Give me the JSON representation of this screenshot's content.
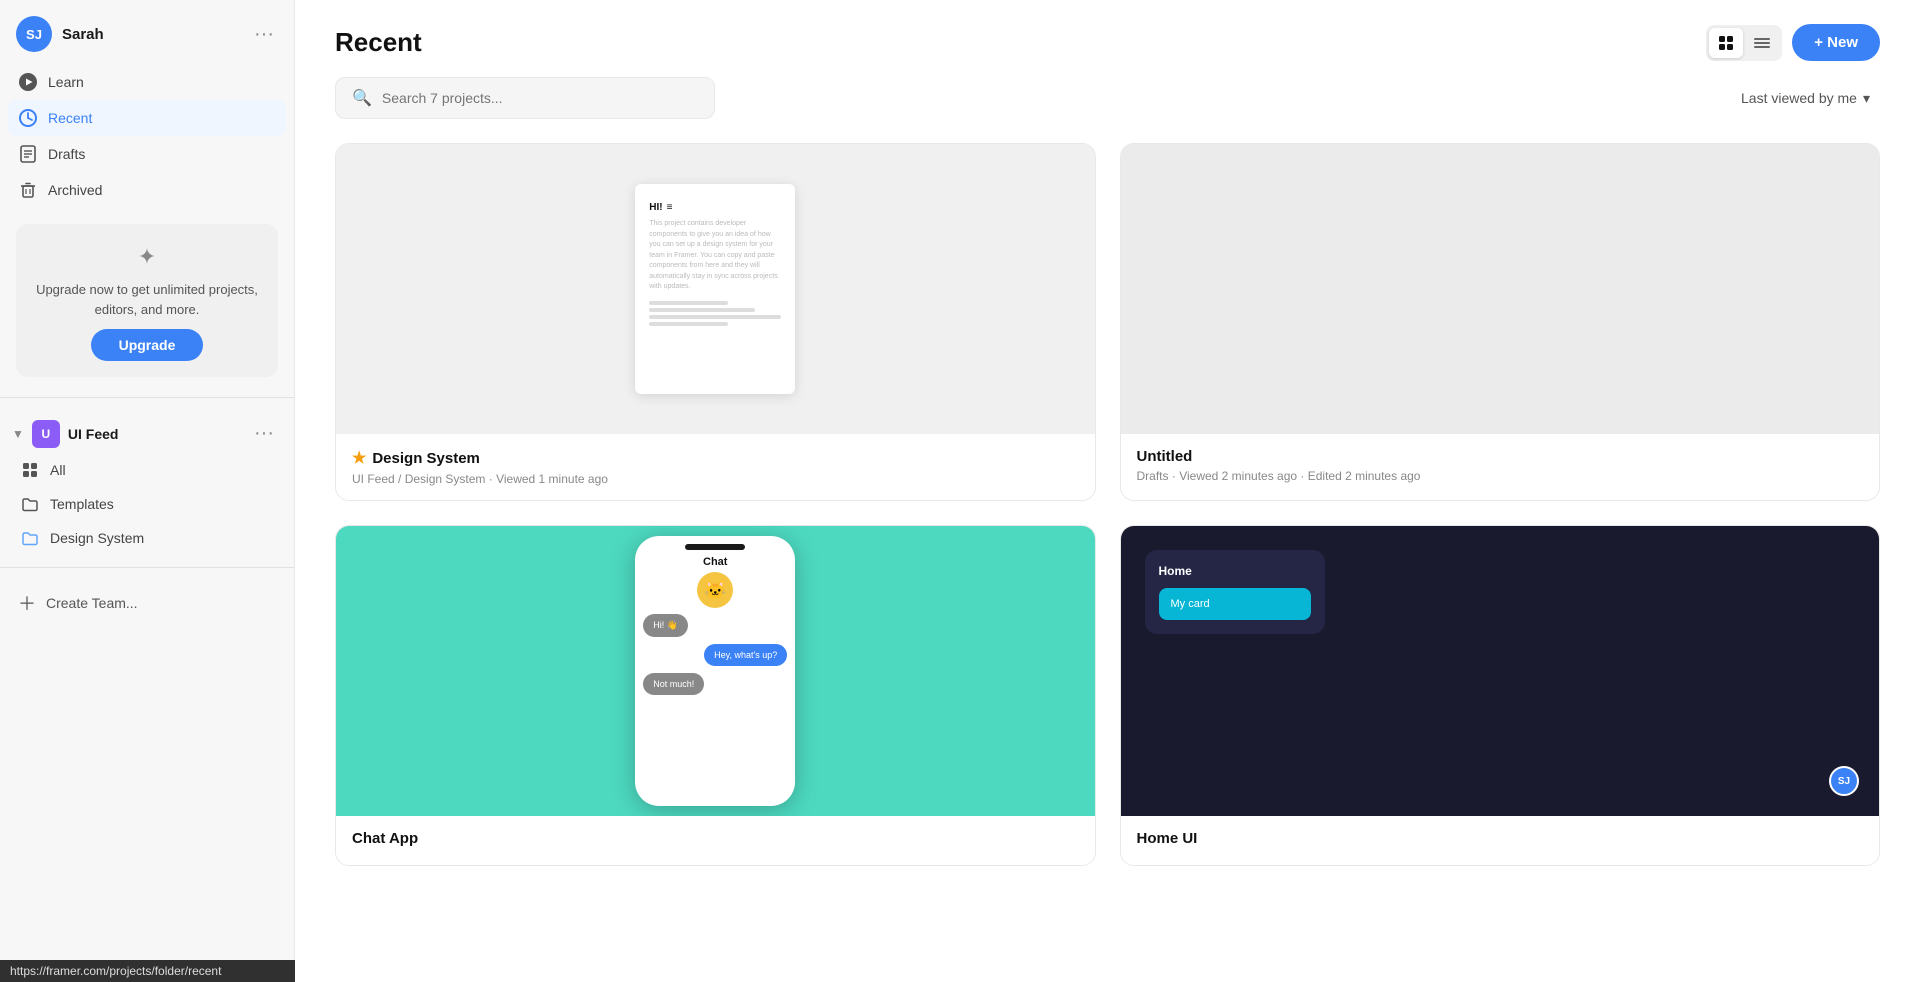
{
  "sidebar": {
    "user": {
      "name": "Sarah",
      "initials": "SJ",
      "avatar_color": "#3b82f6"
    },
    "nav_items": [
      {
        "id": "learn",
        "label": "Learn",
        "icon": "play-icon"
      },
      {
        "id": "recent",
        "label": "Recent",
        "icon": "clock-icon",
        "active": true
      },
      {
        "id": "drafts",
        "label": "Drafts",
        "icon": "draft-icon"
      },
      {
        "id": "archived",
        "label": "Archived",
        "icon": "trash-icon"
      }
    ],
    "upgrade_box": {
      "text": "Upgrade now to get unlimited projects, editors, and more.",
      "button_label": "Upgrade"
    },
    "team": {
      "name": "UI Feed",
      "initials": "U",
      "avatar_color": "#8b5cf6",
      "sub_items": [
        {
          "id": "all",
          "label": "All",
          "icon": "grid-icon"
        },
        {
          "id": "templates",
          "label": "Templates",
          "icon": "folder-icon"
        },
        {
          "id": "design-system",
          "label": "Design System",
          "icon": "folder-blue-icon"
        }
      ]
    },
    "create_team_label": "Create Team...",
    "status_url": "https://framer.com/projects/folder/recent"
  },
  "main": {
    "title": "Recent",
    "new_button_label": "+ New",
    "search": {
      "placeholder": "Search 7 projects...",
      "value": ""
    },
    "sort_label": "Last viewed by me",
    "projects": [
      {
        "id": "design-system",
        "name": "Design System",
        "starred": true,
        "type": "design-system",
        "location": "UI Feed / Design System",
        "meta": "Viewed 1 minute ago"
      },
      {
        "id": "untitled",
        "name": "Untitled",
        "starred": false,
        "type": "empty",
        "location": "Drafts",
        "meta": "Viewed 2 minutes ago · Edited 2 minutes ago"
      },
      {
        "id": "chat-app",
        "name": "Chat App",
        "starred": false,
        "type": "chat",
        "location": "",
        "meta": ""
      },
      {
        "id": "home-ui",
        "name": "Home UI",
        "starred": false,
        "type": "home",
        "location": "",
        "meta": ""
      }
    ]
  }
}
